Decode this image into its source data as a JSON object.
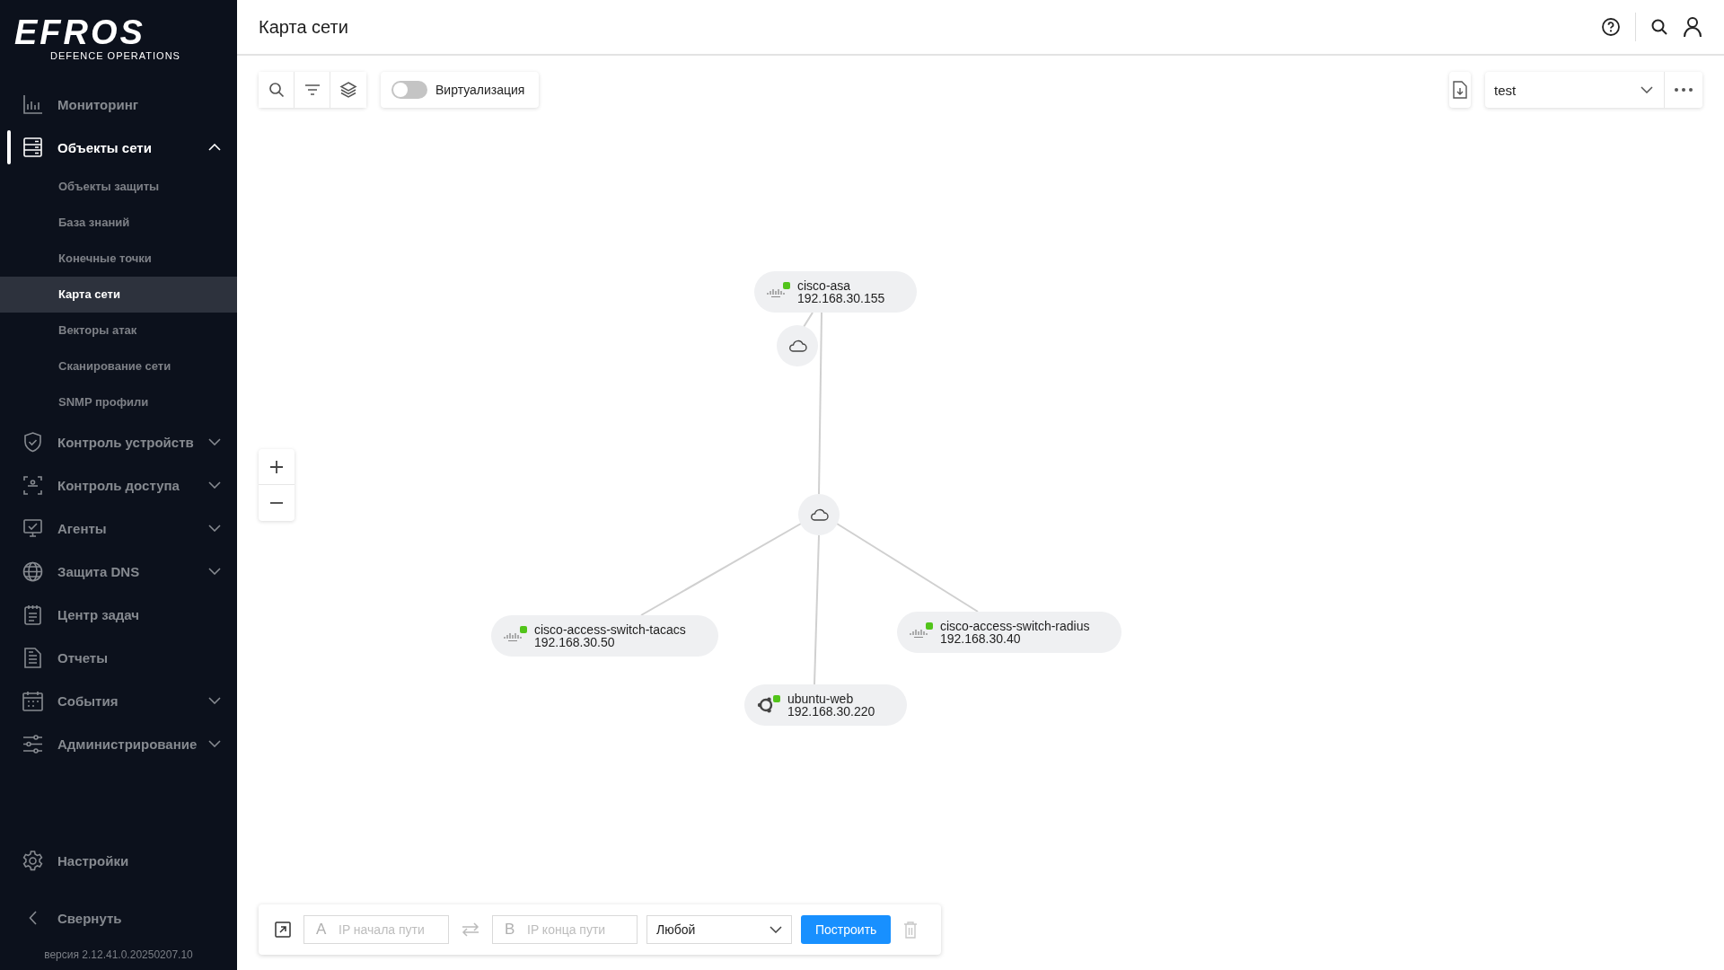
{
  "logo": {
    "wordmark": "EFROS",
    "tagline": "DEFENCE OPERATIONS"
  },
  "sidebar": {
    "items": [
      {
        "label": "Мониторинг",
        "selected": false
      },
      {
        "label": "Объекты сети",
        "selected": true,
        "expanded": true,
        "children": [
          {
            "label": "Объекты защиты",
            "selected": false
          },
          {
            "label": "База знаний",
            "selected": false
          },
          {
            "label": "Конечные точки",
            "selected": false
          },
          {
            "label": "Карта сети",
            "selected": true
          },
          {
            "label": "Векторы атак",
            "selected": false
          },
          {
            "label": "Сканирование сети",
            "selected": false
          },
          {
            "label": "SNMP профили",
            "selected": false
          }
        ]
      },
      {
        "label": "Контроль устройств",
        "selected": false,
        "expanded": false
      },
      {
        "label": "Контроль доступа",
        "selected": false,
        "expanded": false
      },
      {
        "label": "Агенты",
        "selected": false,
        "expanded": false
      },
      {
        "label": "Защита DNS",
        "selected": false,
        "expanded": false
      },
      {
        "label": "Центр задач",
        "selected": false
      },
      {
        "label": "Отчеты",
        "selected": false
      },
      {
        "label": "События",
        "selected": false,
        "expanded": false
      },
      {
        "label": "Администрирование",
        "selected": false,
        "expanded": false
      }
    ],
    "settings": {
      "label": "Настройки"
    },
    "collapse": {
      "label": "Свернуть"
    },
    "version": "версия 2.12.41.0.20250207.10"
  },
  "header": {
    "title": "Карта сети"
  },
  "toolbar": {
    "virtualization": {
      "label": "Виртуализация",
      "on": false
    },
    "map_select": {
      "value": "test"
    }
  },
  "map": {
    "nodes": [
      {
        "kind": "cisco",
        "name": "cisco-asa",
        "ip": "192.168.30.155",
        "online": true
      },
      {
        "kind": "network"
      },
      {
        "kind": "network"
      },
      {
        "kind": "cisco",
        "name": "cisco-access-switch-tacacs",
        "ip": "192.168.30.50",
        "online": true
      },
      {
        "kind": "cisco",
        "name": "cisco-access-switch-radius",
        "ip": "192.168.30.40",
        "online": true
      },
      {
        "kind": "ubuntu",
        "name": "ubuntu-web",
        "ip": "192.168.30.220",
        "online": true
      }
    ]
  },
  "path_panel": {
    "start": {
      "prefix": "A",
      "placeholder": "IP начала пути"
    },
    "end": {
      "prefix": "B",
      "placeholder": "IP конца пути"
    },
    "protocol": "Любой",
    "build_button": "Построить"
  }
}
